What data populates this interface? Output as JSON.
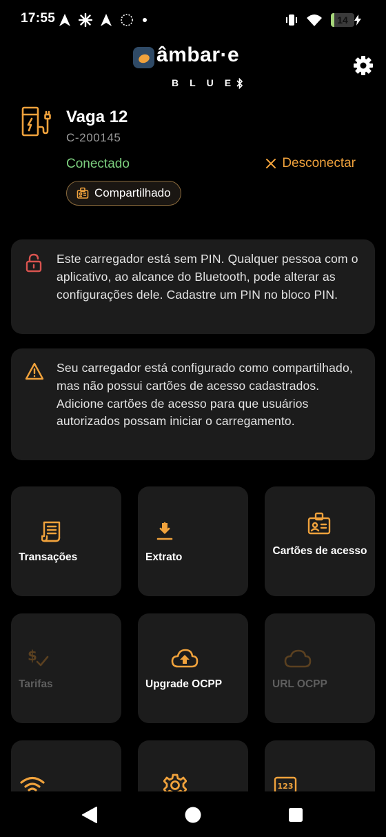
{
  "status_bar": {
    "time": "17:55",
    "battery_level": "14",
    "battery_fraction": 0.14,
    "left_icons": [
      "navigation-arrow-icon",
      "asterisk-icon",
      "navigation-arrow-icon",
      "dotted-circle-icon",
      "dot-icon"
    ],
    "right_icons": [
      "vibrate-icon",
      "wifi-icon",
      "battery-icon",
      "charging-bolt-icon"
    ]
  },
  "header": {
    "logo_text": "âmbar·e",
    "logo_subtext": "BLUE",
    "settings_icon": "gear-icon"
  },
  "charger": {
    "name": "Vaga 12",
    "id": "C-200145",
    "status": "Conectado",
    "disconnect_label": "Desconectar",
    "mode_badge": "Compartilhado",
    "icon": "ev-charger-icon"
  },
  "alerts": {
    "pin_warning": "Este carregador está sem PIN. Qualquer pessoa com o aplicativo, ao alcance do Bluetooth, pode alterar as configurações dele. Cadastre um PIN no bloco PIN.",
    "cards_warning": "Seu carregador está configurado como compartilhado, mas não possui cartões de acesso cadastrados. Adicione cartões de acesso para que usuários autorizados possam iniciar o carregamento."
  },
  "tiles": {
    "transactions": "Transações",
    "statement": "Extrato",
    "access_cards": "Cartões de acesso",
    "tariffs": "Tarifas",
    "upgrade_ocpp": "Upgrade OCPP",
    "url_ocpp": "URL OCPP"
  },
  "colors": {
    "accent": "#F0A23C",
    "connected": "#7CCF7E",
    "lock_red": "#D9534F",
    "tile_bg": "#1C1C1C",
    "disabled": "#5E5E5E"
  }
}
